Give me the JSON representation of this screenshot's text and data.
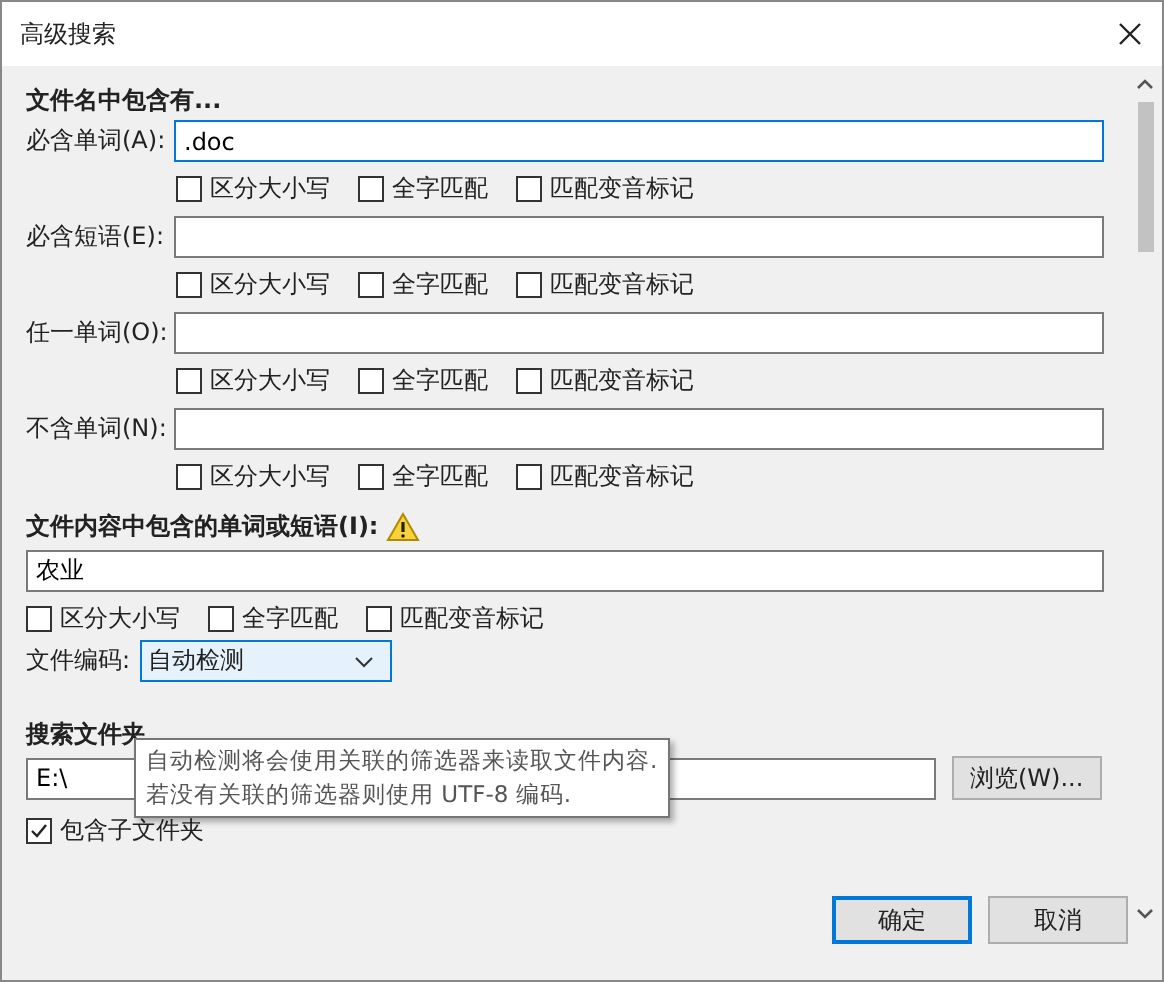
{
  "window": {
    "title": "高级搜索"
  },
  "filename_section": {
    "heading": "文件名中包含有...",
    "rows": [
      {
        "label": "必含单词(A):",
        "value": ".doc",
        "focused": true,
        "options": [
          {
            "label": "区分大小写",
            "checked": false
          },
          {
            "label": "全字匹配",
            "checked": false
          },
          {
            "label": "匹配变音标记",
            "checked": false
          }
        ]
      },
      {
        "label": "必含短语(E):",
        "focused": false,
        "options": [
          {
            "label": "区分大小写",
            "checked": false
          },
          {
            "label": "全字匹配",
            "checked": false
          },
          {
            "label": "匹配变音标记",
            "checked": false
          }
        ]
      },
      {
        "label": "任一单词(O):",
        "focused": false,
        "options": [
          {
            "label": "区分大小写",
            "checked": false
          },
          {
            "label": "全字匹配",
            "checked": false
          },
          {
            "label": "匹配变音标记",
            "checked": false
          }
        ]
      },
      {
        "label": "不含单词(N):",
        "focused": false,
        "options": [
          {
            "label": "区分大小写",
            "checked": false
          },
          {
            "label": "全字匹配",
            "checked": false
          },
          {
            "label": "匹配变音标记",
            "checked": false
          }
        ]
      }
    ]
  },
  "content_section": {
    "heading": "文件内容中包含的单词或短语(I):",
    "value": "农业",
    "options": [
      {
        "label": "区分大小写",
        "checked": false
      },
      {
        "label": "全字匹配",
        "checked": false
      },
      {
        "label": "匹配变音标记",
        "checked": false
      }
    ],
    "encoding_label": "文件编码:",
    "encoding": "自动检测"
  },
  "tooltip": {
    "lines": [
      "自动检测将会使用关联的筛选器来读取文件内容.",
      "若没有关联的筛选器则使用 UTF-8 编码."
    ]
  },
  "folder_section": {
    "heading": "搜索文件夹",
    "value": "E:\\",
    "browse_button": "浏览(W)...",
    "include_subfolders": {
      "label": "包含子文件夹",
      "checked": true
    }
  },
  "buttons": [
    {
      "label": "确定",
      "default": true
    },
    {
      "label": "取消",
      "default": false
    }
  ]
}
